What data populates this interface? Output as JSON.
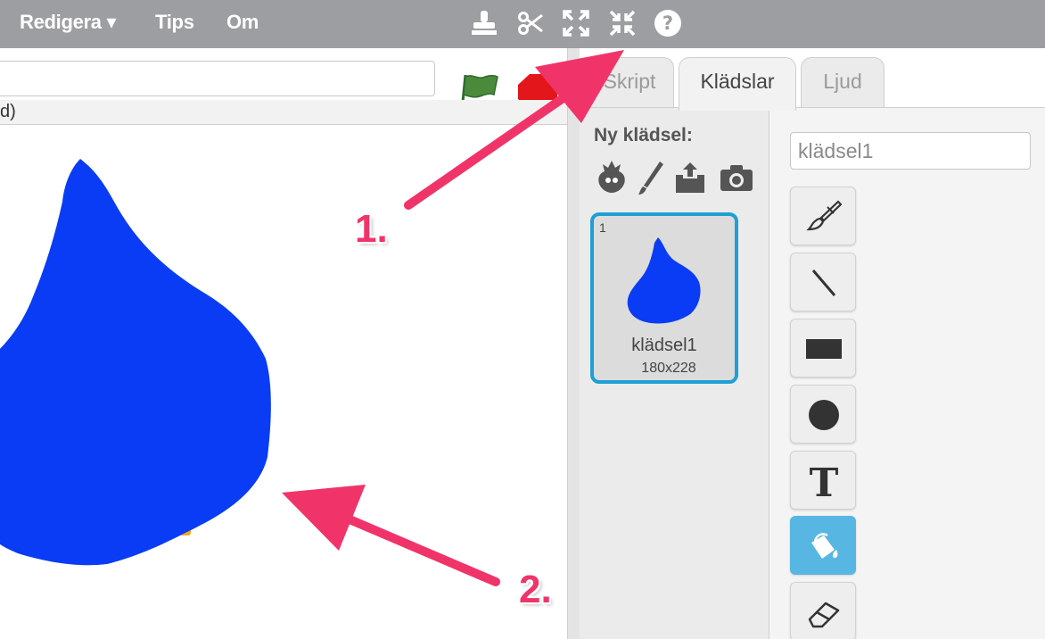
{
  "menubar": {
    "items": [
      {
        "label": "Redigera ▾"
      },
      {
        "label": "Tips"
      },
      {
        "label": "Om"
      }
    ],
    "tools": [
      {
        "icon": "duplicate-stamp-icon"
      },
      {
        "icon": "delete-scissors-icon"
      },
      {
        "icon": "grow-icon"
      },
      {
        "icon": "shrink-icon"
      },
      {
        "icon": "help-icon"
      }
    ]
  },
  "stage": {
    "info_text": "d)",
    "sprite_color": "#0040ff"
  },
  "tabs": [
    {
      "label": "Skript"
    },
    {
      "label": "Klädslar"
    },
    {
      "label": "Ljud"
    }
  ],
  "costumes_panel": {
    "heading": "Ny klädsel:",
    "new_icons": [
      "sprite-library-icon",
      "paint-brush-icon",
      "upload-icon",
      "camera-icon"
    ],
    "items": [
      {
        "number": "1",
        "name": "klädsel1",
        "size": "180x228"
      }
    ]
  },
  "editor": {
    "costume_name_value": "klädsel1",
    "tools": [
      "brush-icon",
      "line-icon",
      "rectangle-icon",
      "ellipse-icon",
      "text-icon",
      "fill-bucket-icon",
      "eraser-icon"
    ],
    "selected_tool": "fill-bucket-icon"
  },
  "annotations": [
    {
      "label": "1."
    },
    {
      "label": "2."
    }
  ],
  "colors": {
    "menubar": "#9c9ea1",
    "accent": "#1f9fd6",
    "annotation": "#f03469",
    "selected_tool": "#58b6e2"
  }
}
